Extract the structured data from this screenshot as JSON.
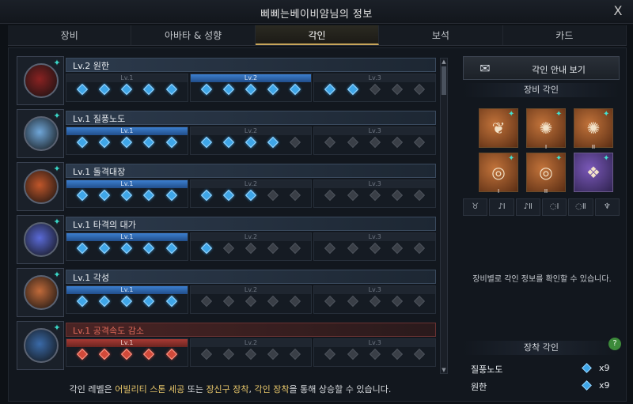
{
  "window": {
    "title": "삐삐는베이비얌님의 정보",
    "close_label": "X"
  },
  "tabs": [
    {
      "label": "장비",
      "active": false
    },
    {
      "label": "아바타 & 성향",
      "active": false
    },
    {
      "label": "각인",
      "active": true
    },
    {
      "label": "보석",
      "active": false
    },
    {
      "label": "카드",
      "active": false
    }
  ],
  "engravings": [
    {
      "name": "Lv.2 원한",
      "levels": [
        "Lv.1",
        "Lv.2",
        "Lv.3"
      ],
      "active_level": 2,
      "filled": 12,
      "penalty": false
    },
    {
      "name": "Lv.1 질풍노도",
      "levels": [
        "Lv.1",
        "Lv.2",
        "Lv.3"
      ],
      "active_level": 1,
      "filled": 9,
      "penalty": false
    },
    {
      "name": "Lv.1 돌격대장",
      "levels": [
        "Lv.1",
        "Lv.2",
        "Lv.3"
      ],
      "active_level": 1,
      "filled": 8,
      "penalty": false
    },
    {
      "name": "Lv.1 타격의 대가",
      "levels": [
        "Lv.1",
        "Lv.2",
        "Lv.3"
      ],
      "active_level": 1,
      "filled": 6,
      "penalty": false
    },
    {
      "name": "Lv.1 각성",
      "levels": [
        "Lv.1",
        "Lv.2",
        "Lv.3"
      ],
      "active_level": 1,
      "filled": 5,
      "penalty": false
    },
    {
      "name": "Lv.1 공격속도 감소",
      "levels": [
        "Lv.1",
        "Lv.2",
        "Lv.3"
      ],
      "active_level": 1,
      "filled": 5,
      "penalty": true
    }
  ],
  "footer": {
    "prefix": "각인 레벨은 ",
    "hl1": "어빌리티 스톤 세공",
    "mid1": " 또는 ",
    "hl2": "장신구 장착",
    "mid2": ", ",
    "hl3": "각인 장착",
    "suffix": "을 통해 상승할 수 있습니다."
  },
  "right": {
    "guide_button": "각인 안내 보기",
    "equip_engrave_title": "장비 각인",
    "slots": [
      {
        "icon": "necklace-icon",
        "glyph": "❦",
        "roman": "",
        "badge": true,
        "purple": false
      },
      {
        "icon": "earring-icon",
        "glyph": "✺",
        "roman": "I",
        "badge": true,
        "purple": false
      },
      {
        "icon": "earring-icon",
        "glyph": "✺",
        "roman": "II",
        "badge": true,
        "purple": false
      },
      {
        "icon": "ring-icon",
        "glyph": "◎",
        "roman": "I",
        "badge": true,
        "purple": false
      },
      {
        "icon": "ring-icon",
        "glyph": "◎",
        "roman": "II",
        "badge": true,
        "purple": false
      },
      {
        "icon": "ability-stone-icon",
        "glyph": "❖",
        "roman": "",
        "badge": true,
        "purple": true
      }
    ],
    "filters": [
      "♉",
      "♪Ⅰ",
      "♪Ⅱ",
      "◌Ⅰ",
      "◌Ⅱ",
      "♆"
    ],
    "info_text": "장비별로 각인 정보를 확인할 수 있습니다.",
    "equipped_title": "장착 각인",
    "help_label": "?",
    "equipped": [
      {
        "name": "질풍노도",
        "count": "x9"
      },
      {
        "name": "원한",
        "count": "x9"
      }
    ]
  }
}
